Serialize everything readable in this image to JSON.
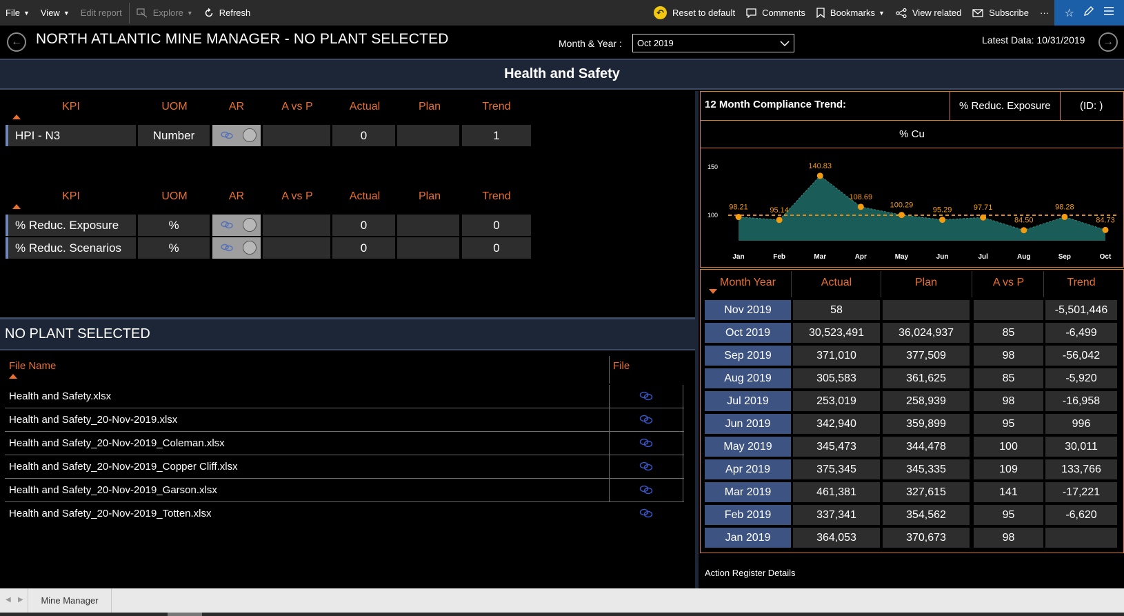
{
  "toolbar": {
    "file": "File",
    "view": "View",
    "edit_report": "Edit report",
    "explore": "Explore",
    "refresh": "Refresh",
    "reset": "Reset to default",
    "comments": "Comments",
    "bookmarks": "Bookmarks",
    "view_related": "View related",
    "subscribe": "Subscribe",
    "more": "···"
  },
  "header": {
    "title": "NORTH ATLANTIC MINE MANAGER - NO PLANT SELECTED",
    "month_label": "Month & Year :",
    "month_value": "Oct 2019",
    "latest_data": "Latest Data: 10/31/2019"
  },
  "section_title": "Health and Safety",
  "kpi_columns": [
    "KPI",
    "UOM",
    "AR",
    "A vs P",
    "Actual",
    "Plan",
    "Trend"
  ],
  "kpi_table_1": [
    {
      "kpi": "HPI - N3",
      "uom": "Number",
      "avp": "",
      "actual": "0",
      "plan": "",
      "trend": "1"
    }
  ],
  "kpi_table_2": [
    {
      "kpi": "% Reduc. Exposure",
      "uom": "%",
      "avp": "",
      "actual": "0",
      "plan": "",
      "trend": "0"
    },
    {
      "kpi": "% Reduc. Scenarios",
      "uom": "%",
      "avp": "",
      "actual": "0",
      "plan": "",
      "trend": "0"
    }
  ],
  "plant_header": "NO PLANT SELECTED",
  "files": {
    "col_name": "File Name",
    "col_file": "File",
    "rows": [
      "Health and Safety.xlsx",
      "Health and Safety_20-Nov-2019.xlsx",
      "Health and Safety_20-Nov-2019_Coleman.xlsx",
      "Health and Safety_20-Nov-2019_Copper Cliff.xlsx",
      "Health and Safety_20-Nov-2019_Garson.xlsx",
      "Health and Safety_20-Nov-2019_Totten.xlsx"
    ]
  },
  "trend_panel": {
    "title": "12 Month Compliance Trend:",
    "kpi": "% Reduc. Exposure",
    "id": "(ID: )",
    "chart_title": "% Cu"
  },
  "chart_data": {
    "type": "area",
    "title": "% Cu",
    "categories": [
      "Jan",
      "Feb",
      "Mar",
      "Apr",
      "May",
      "Jun",
      "Jul",
      "Aug",
      "Sep",
      "Oct"
    ],
    "values": [
      98.21,
      95.14,
      140.83,
      108.69,
      100.29,
      95.29,
      97.71,
      84.5,
      98.28,
      84.73
    ],
    "data_labels": [
      "98.21",
      "95.14",
      "140.83",
      "108.69",
      "100.29",
      "95.29",
      "97.71",
      "84.50",
      "98.28",
      "84.73"
    ],
    "y_ticks": [
      100,
      150
    ],
    "ylim": [
      75,
      155
    ],
    "reference_line": 100,
    "colors": {
      "area": "#1a5c57",
      "marker": "#f39c12",
      "reference": "#e08b1a",
      "label": "#f39c12"
    }
  },
  "month_table": {
    "columns": [
      "Month Year",
      "Actual",
      "Plan",
      "A vs P",
      "Trend"
    ],
    "rows": [
      [
        "Nov 2019",
        "58",
        "",
        "",
        "-5,501,446"
      ],
      [
        "Oct 2019",
        "30,523,491",
        "36,024,937",
        "85",
        "-6,499"
      ],
      [
        "Sep 2019",
        "371,010",
        "377,509",
        "98",
        "-56,042"
      ],
      [
        "Aug 2019",
        "305,583",
        "361,625",
        "85",
        "-5,920"
      ],
      [
        "Jul 2019",
        "253,019",
        "258,939",
        "98",
        "-16,958"
      ],
      [
        "Jun 2019",
        "342,940",
        "359,899",
        "95",
        "996"
      ],
      [
        "May 2019",
        "345,473",
        "344,478",
        "100",
        "30,011"
      ],
      [
        "Apr 2019",
        "375,345",
        "345,335",
        "109",
        "133,766"
      ],
      [
        "Mar 2019",
        "461,381",
        "327,615",
        "141",
        "-17,221"
      ],
      [
        "Feb 2019",
        "337,341",
        "354,562",
        "95",
        "-6,620"
      ],
      [
        "Jan 2019",
        "364,053",
        "370,673",
        "98",
        ""
      ]
    ]
  },
  "action_register": "Action Register Details",
  "tabs": [
    "Mine Manager"
  ]
}
